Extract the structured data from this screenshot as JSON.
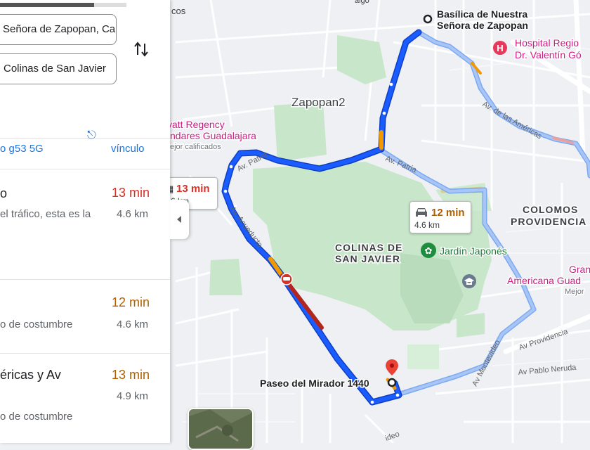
{
  "search": {
    "origin_value": "Señora de Zapopan, Ca",
    "destination_value": "Colinas de San Javier",
    "swap_icon": "swap-vertical-icon"
  },
  "panel": {
    "wifi_text": "o g53 5G",
    "link_label": "vínculo",
    "routes": [
      {
        "title": "o",
        "desc": "el tráfico, esta es la",
        "time": "13 min",
        "distance": "4.6 km",
        "time_color": "#d93025"
      },
      {
        "title": "",
        "desc": "o de costumbre",
        "time": "12 min",
        "distance": "4.6 km",
        "time_color": "#b06000"
      },
      {
        "title": "éricas y Av",
        "desc": "o de costumbre",
        "time": "13 min",
        "distance": "4.9 km",
        "time_color": "#b06000"
      }
    ]
  },
  "map": {
    "places": {
      "basilica_line1": "Basílica de Nuestra",
      "basilica_line2": "Señora de Zapopan",
      "hospital_line1": "Hospital Regio",
      "hospital_line2": "Dr. Valentín Gó",
      "zapopan": "Zapopan2",
      "hyatt_line1": "yatt Regency",
      "hyatt_line2": "ndares Guadalajara",
      "hyatt_line3": "ejor calificados",
      "colinas_line1": "COLINAS DE",
      "colinas_line2": "SAN JAVIER",
      "jardin": "Jardín Japonés",
      "colomos_line1": "COLOMOS",
      "colomos_line2": "PROVIDENCIA",
      "americana_line1": "Gran",
      "americana_line2": "Americana Guad",
      "americana_line3": "Mejor",
      "paseo": "Paseo del Mirador 1440",
      "top_left": "cos",
      "top_mid": "algo"
    },
    "streets": {
      "patria_left": "Av. Patria",
      "patria_right": "Av. Patria",
      "americas": "Av. de las Américas",
      "acueducto": "Av. Acueducto",
      "providencia": "Av Providencia",
      "montevideo": "Av Montevideo",
      "pablo_neruda": "Av Pablo Neruda",
      "bottom": "ideo"
    },
    "callout_main": {
      "time": "13 min",
      "sub": "6 km"
    },
    "callout_alt": {
      "time": "12 min",
      "sub": "4.6 km"
    },
    "colors": {
      "route_primary": "#1a5cff",
      "route_alt": "#8fb0f5",
      "traffic_red": "#b3261e",
      "traffic_orange": "#f29900",
      "park": "#c8e6c9"
    }
  }
}
